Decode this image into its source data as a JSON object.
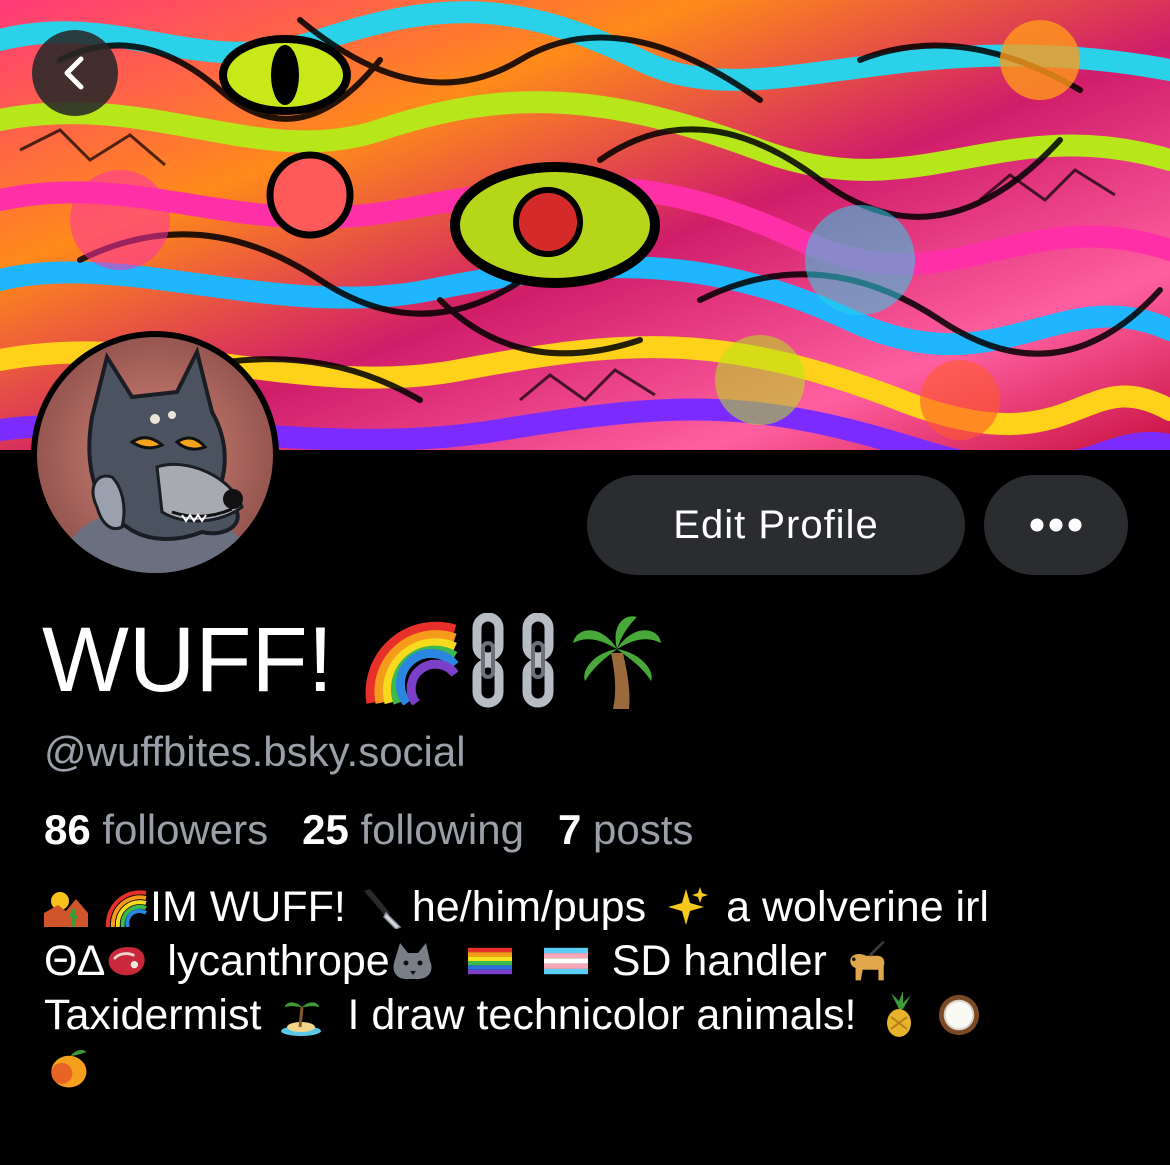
{
  "profile": {
    "display_name": "WUFF!",
    "display_name_emojis": [
      "rainbow-icon",
      "chains-icon",
      "palm-tree-icon"
    ],
    "handle": "@wuffbites.bsky.social",
    "edit_label": "Edit Profile",
    "more_label": "•••"
  },
  "stats": {
    "followers_count": "86",
    "followers_label": "followers",
    "following_count": "25",
    "following_label": "following",
    "posts_count": "7",
    "posts_label": "posts"
  },
  "bio": {
    "line1": {
      "a": "IM WUFF!",
      "b": "he/him/pups",
      "c": "a wolverine irl"
    },
    "line2": {
      "a": "ΘΔ",
      "b": "lycanthrope",
      "c": "SD handler"
    },
    "line3": {
      "a": "Taxidermist",
      "b": "I draw technicolor animals!"
    },
    "emojis": [
      "desert-sunset-icon",
      "rainbow-icon",
      "knife-icon",
      "sparkles-icon",
      "meat-icon",
      "wolf-icon",
      "pride-flag-icon",
      "trans-flag-icon",
      "guide-dog-icon",
      "island-icon",
      "pineapple-icon",
      "coconut-icon",
      "mango-icon"
    ]
  },
  "colors": {
    "background": "#000000",
    "button_bg": "#2a2c30",
    "secondary_text": "#9a9fa8"
  }
}
